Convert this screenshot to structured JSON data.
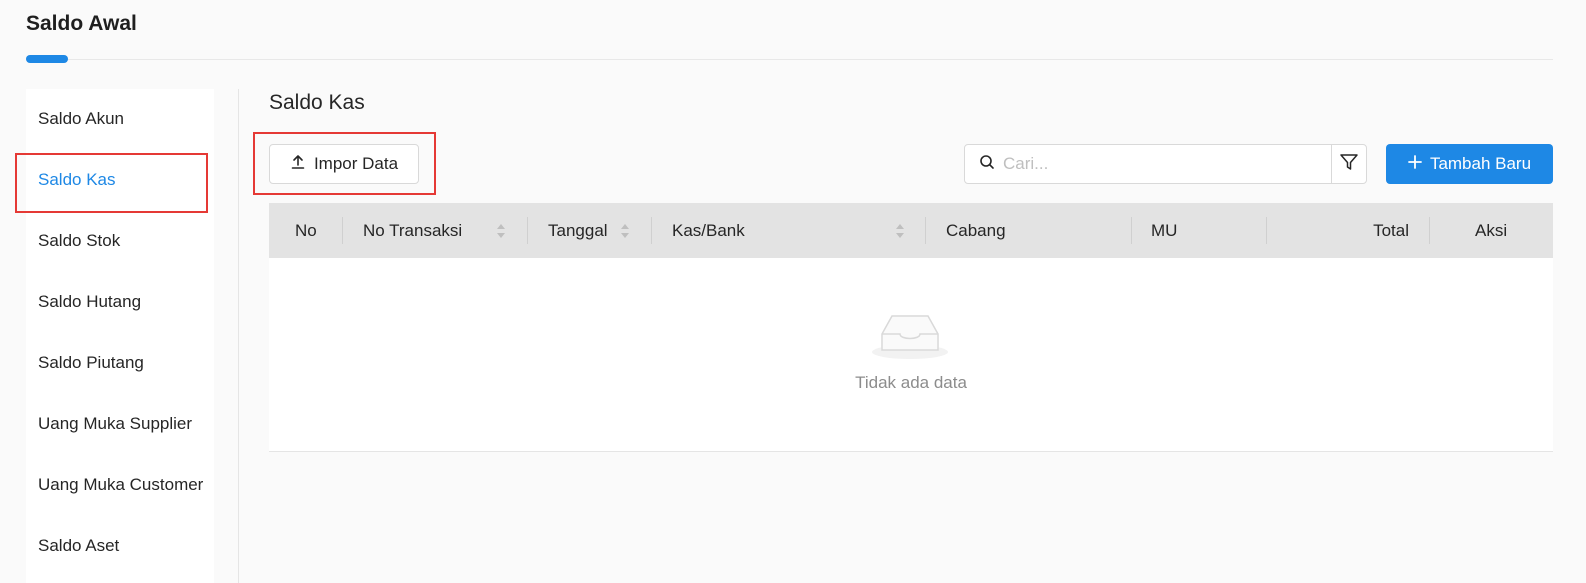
{
  "page": {
    "title": "Saldo Awal"
  },
  "sidebar": {
    "items": [
      {
        "label": "Saldo Akun"
      },
      {
        "label": "Saldo Kas",
        "active": true
      },
      {
        "label": "Saldo Stok"
      },
      {
        "label": "Saldo Hutang"
      },
      {
        "label": "Saldo Piutang"
      },
      {
        "label": "Uang Muka Supplier"
      },
      {
        "label": "Uang Muka Customer"
      },
      {
        "label": "Saldo Aset"
      }
    ]
  },
  "main": {
    "section_title": "Saldo Kas",
    "import_label": "Impor Data",
    "search_placeholder": "Cari...",
    "add_label": "Tambah Baru",
    "table": {
      "columns": [
        "No",
        "No Transaksi",
        "Tanggal",
        "Kas/Bank",
        "Cabang",
        "MU",
        "Total",
        "Aksi"
      ],
      "sortable": [
        "No Transaksi",
        "Tanggal",
        "Kas/Bank"
      ],
      "rows": [],
      "empty_text": "Tidak ada data"
    }
  },
  "colors": {
    "accent": "#1e88e5",
    "highlight": "#e53935",
    "header_bg": "#e3e3e3"
  },
  "icons": [
    "upload-icon",
    "search-icon",
    "filter-icon",
    "plus-icon",
    "sort-icon",
    "empty-inbox-icon"
  ]
}
